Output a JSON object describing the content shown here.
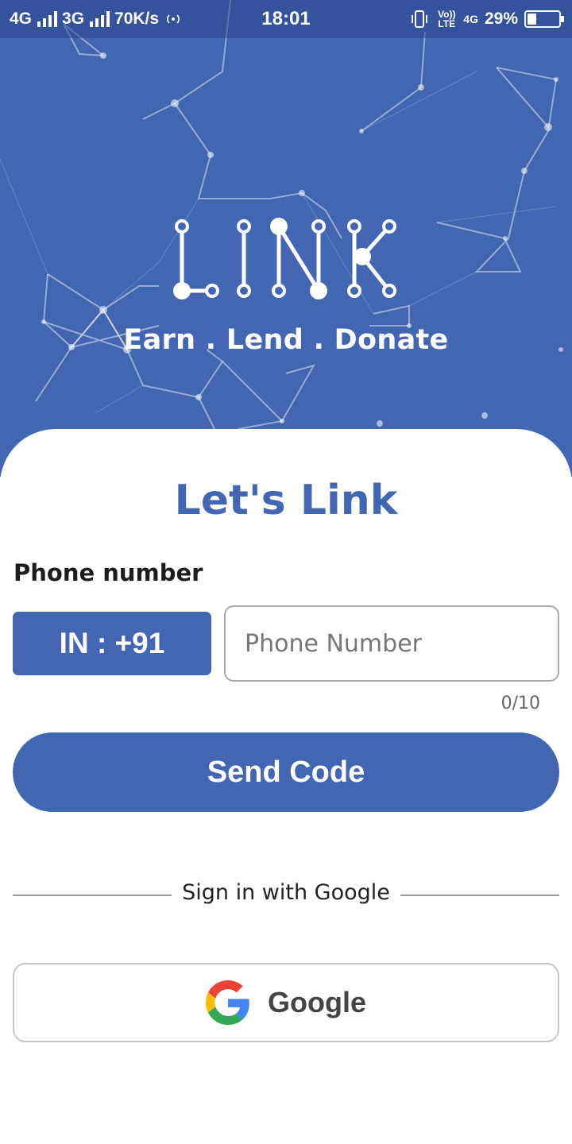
{
  "status_bar": {
    "network_1": "4G",
    "network_2": "3G",
    "speed": "70K/s",
    "time": "18:01",
    "volte": "Vo)) LTE",
    "network_right": "4G",
    "battery_text": "29%",
    "battery_level": 0.29
  },
  "header": {
    "logo_text": "LINK",
    "tagline": "Earn . Lend . Donate"
  },
  "login": {
    "title": "Let's Link",
    "phone_label": "Phone number",
    "country_code": "IN : +91",
    "phone_value": "",
    "phone_placeholder": "Phone Number",
    "char_counter": "0/10",
    "send_button": "Send Code",
    "divider_text": "Sign in with Google",
    "google_button": "Google"
  },
  "colors": {
    "brand": "#4266b2",
    "white": "#ffffff"
  },
  "icons": {
    "google": "google-g-icon",
    "vibrate": "vibrate-icon",
    "signal": "signal-bars-icon",
    "battery": "battery-icon"
  }
}
